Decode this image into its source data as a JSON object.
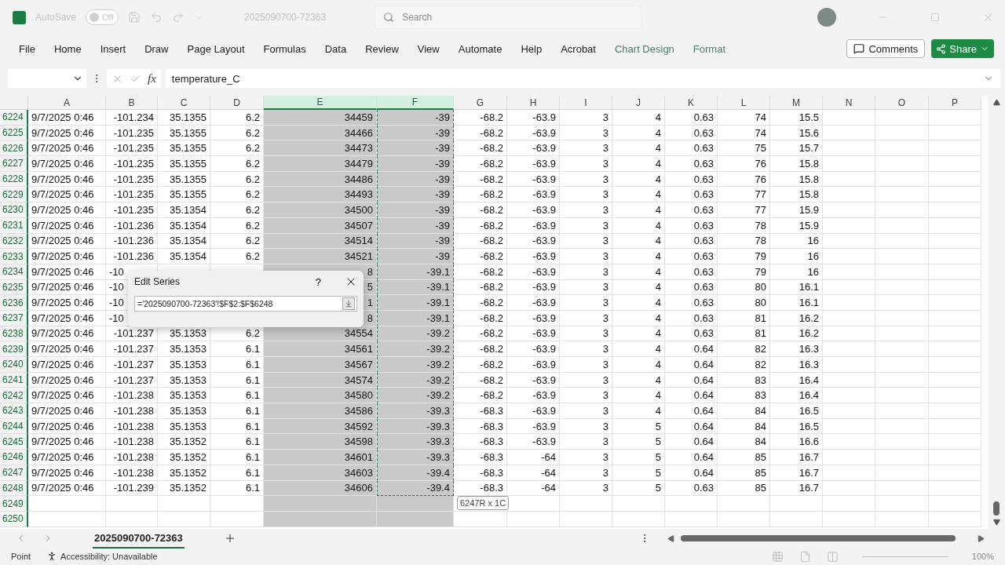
{
  "title_bar": {
    "autosave_label": "AutoSave",
    "autosave": {
      "on": false,
      "label": "Off"
    },
    "file_name": "2025090700-72363",
    "search": {
      "placeholder": "Search"
    }
  },
  "ribbon_tabs": [
    {
      "label": "File",
      "kind": "normal"
    },
    {
      "label": "Home",
      "kind": "normal"
    },
    {
      "label": "Insert",
      "kind": "normal"
    },
    {
      "label": "Draw",
      "kind": "normal"
    },
    {
      "label": "Page Layout",
      "kind": "normal"
    },
    {
      "label": "Formulas",
      "kind": "normal"
    },
    {
      "label": "Data",
      "kind": "normal"
    },
    {
      "label": "Review",
      "kind": "normal"
    },
    {
      "label": "View",
      "kind": "normal"
    },
    {
      "label": "Automate",
      "kind": "normal"
    },
    {
      "label": "Help",
      "kind": "normal"
    },
    {
      "label": "Acrobat",
      "kind": "normal"
    },
    {
      "label": "Chart Design",
      "kind": "contextual"
    },
    {
      "label": "Format",
      "kind": "contextual"
    }
  ],
  "ribbon_buttons": {
    "comments": "Comments",
    "share": "Share"
  },
  "formula_bar": {
    "fx": "fx",
    "value": "temperature_C"
  },
  "columns": [
    {
      "label": "A",
      "selected": false,
      "marquee": false
    },
    {
      "label": "B",
      "selected": false,
      "marquee": false
    },
    {
      "label": "C",
      "selected": false,
      "marquee": false
    },
    {
      "label": "D",
      "selected": false,
      "marquee": false
    },
    {
      "label": "E",
      "selected": true,
      "marquee": false
    },
    {
      "label": "F",
      "selected": true,
      "marquee": true
    },
    {
      "label": "G",
      "selected": false,
      "marquee": false
    },
    {
      "label": "H",
      "selected": false,
      "marquee": false
    },
    {
      "label": "I",
      "selected": false,
      "marquee": false
    },
    {
      "label": "J",
      "selected": false,
      "marquee": false
    },
    {
      "label": "K",
      "selected": false,
      "marquee": false
    },
    {
      "label": "L",
      "selected": false,
      "marquee": false
    },
    {
      "label": "M",
      "selected": false,
      "marquee": false
    },
    {
      "label": "N",
      "selected": false,
      "marquee": false
    },
    {
      "label": "O",
      "selected": false,
      "marquee": false
    },
    {
      "label": "P",
      "selected": false,
      "marquee": false
    }
  ],
  "rows": [
    {
      "n": "6224",
      "cells": [
        "9/7/2025 0:46",
        "-101.234",
        "35.1355",
        "6.2",
        "34459",
        "-39",
        "-68.2",
        "-63.9",
        "3",
        "4",
        "0.63",
        "74",
        "15.5"
      ]
    },
    {
      "n": "6225",
      "cells": [
        "9/7/2025 0:46",
        "-101.235",
        "35.1355",
        "6.2",
        "34466",
        "-39",
        "-68.2",
        "-63.9",
        "3",
        "4",
        "0.63",
        "74",
        "15.6"
      ]
    },
    {
      "n": "6226",
      "cells": [
        "9/7/2025 0:46",
        "-101.235",
        "35.1355",
        "6.2",
        "34473",
        "-39",
        "-68.2",
        "-63.9",
        "3",
        "4",
        "0.63",
        "75",
        "15.7"
      ]
    },
    {
      "n": "6227",
      "cells": [
        "9/7/2025 0:46",
        "-101.235",
        "35.1355",
        "6.2",
        "34479",
        "-39",
        "-68.2",
        "-63.9",
        "3",
        "4",
        "0.63",
        "76",
        "15.8"
      ]
    },
    {
      "n": "6228",
      "cells": [
        "9/7/2025 0:46",
        "-101.235",
        "35.1355",
        "6.2",
        "34486",
        "-39",
        "-68.2",
        "-63.9",
        "3",
        "4",
        "0.63",
        "76",
        "15.8"
      ]
    },
    {
      "n": "6229",
      "cells": [
        "9/7/2025 0:46",
        "-101.235",
        "35.1355",
        "6.2",
        "34493",
        "-39",
        "-68.2",
        "-63.9",
        "3",
        "4",
        "0.63",
        "77",
        "15.8"
      ]
    },
    {
      "n": "6230",
      "cells": [
        "9/7/2025 0:46",
        "-101.235",
        "35.1354",
        "6.2",
        "34500",
        "-39",
        "-68.2",
        "-63.9",
        "3",
        "4",
        "0.63",
        "77",
        "15.9"
      ]
    },
    {
      "n": "6231",
      "cells": [
        "9/7/2025 0:46",
        "-101.236",
        "35.1354",
        "6.2",
        "34507",
        "-39",
        "-68.2",
        "-63.9",
        "3",
        "4",
        "0.63",
        "78",
        "15.9"
      ]
    },
    {
      "n": "6232",
      "cells": [
        "9/7/2025 0:46",
        "-101.236",
        "35.1354",
        "6.2",
        "34514",
        "-39",
        "-68.2",
        "-63.9",
        "3",
        "4",
        "0.63",
        "78",
        "16"
      ]
    },
    {
      "n": "6233",
      "cells": [
        "9/7/2025 0:46",
        "-101.236",
        "35.1354",
        "6.2",
        "34521",
        "-39",
        "-68.2",
        "-63.9",
        "3",
        "4",
        "0.63",
        "79",
        "16"
      ]
    },
    {
      "n": "6234",
      "cells": [
        "9/7/2025 0:46",
        "-10",
        null,
        null,
        "8",
        "-39.1",
        "-68.2",
        "-63.9",
        "3",
        "4",
        "0.63",
        "79",
        "16"
      ]
    },
    {
      "n": "6235",
      "cells": [
        "9/7/2025 0:46",
        "-10",
        null,
        null,
        "5",
        "-39.1",
        "-68.2",
        "-63.9",
        "3",
        "4",
        "0.63",
        "80",
        "16.1"
      ]
    },
    {
      "n": "6236",
      "cells": [
        "9/7/2025 0:46",
        "-10",
        null,
        null,
        "1",
        "-39.1",
        "-68.2",
        "-63.9",
        "3",
        "4",
        "0.63",
        "80",
        "16.1"
      ]
    },
    {
      "n": "6237",
      "cells": [
        "9/7/2025 0:46",
        "-10",
        null,
        null,
        "8",
        "-39.1",
        "-68.2",
        "-63.9",
        "3",
        "4",
        "0.63",
        "81",
        "16.2"
      ]
    },
    {
      "n": "6238",
      "cells": [
        "9/7/2025 0:46",
        "-101.237",
        "35.1353",
        "6.2",
        "34554",
        "-39.2",
        "-68.2",
        "-63.9",
        "3",
        "4",
        "0.63",
        "81",
        "16.2"
      ]
    },
    {
      "n": "6239",
      "cells": [
        "9/7/2025 0:46",
        "-101.237",
        "35.1353",
        "6.1",
        "34561",
        "-39.2",
        "-68.2",
        "-63.9",
        "3",
        "4",
        "0.64",
        "82",
        "16.3"
      ]
    },
    {
      "n": "6240",
      "cells": [
        "9/7/2025 0:46",
        "-101.237",
        "35.1353",
        "6.1",
        "34567",
        "-39.2",
        "-68.2",
        "-63.9",
        "3",
        "4",
        "0.64",
        "82",
        "16.3"
      ]
    },
    {
      "n": "6241",
      "cells": [
        "9/7/2025 0:46",
        "-101.237",
        "35.1353",
        "6.1",
        "34574",
        "-39.2",
        "-68.2",
        "-63.9",
        "3",
        "4",
        "0.64",
        "83",
        "16.4"
      ]
    },
    {
      "n": "6242",
      "cells": [
        "9/7/2025 0:46",
        "-101.238",
        "35.1353",
        "6.1",
        "34580",
        "-39.2",
        "-68.2",
        "-63.9",
        "3",
        "4",
        "0.64",
        "83",
        "16.4"
      ]
    },
    {
      "n": "6243",
      "cells": [
        "9/7/2025 0:46",
        "-101.238",
        "35.1353",
        "6.1",
        "34586",
        "-39.3",
        "-68.3",
        "-63.9",
        "3",
        "4",
        "0.64",
        "84",
        "16.5"
      ]
    },
    {
      "n": "6244",
      "cells": [
        "9/7/2025 0:46",
        "-101.238",
        "35.1353",
        "6.1",
        "34592",
        "-39.3",
        "-68.3",
        "-63.9",
        "3",
        "5",
        "0.64",
        "84",
        "16.5"
      ]
    },
    {
      "n": "6245",
      "cells": [
        "9/7/2025 0:46",
        "-101.238",
        "35.1352",
        "6.1",
        "34598",
        "-39.3",
        "-68.3",
        "-63.9",
        "3",
        "5",
        "0.64",
        "84",
        "16.6"
      ]
    },
    {
      "n": "6246",
      "cells": [
        "9/7/2025 0:46",
        "-101.238",
        "35.1352",
        "6.1",
        "34601",
        "-39.3",
        "-68.3",
        "-64",
        "3",
        "5",
        "0.64",
        "85",
        "16.7"
      ]
    },
    {
      "n": "6247",
      "cells": [
        "9/7/2025 0:46",
        "-101.238",
        "35.1352",
        "6.1",
        "34603",
        "-39.4",
        "-68.3",
        "-64",
        "3",
        "5",
        "0.64",
        "85",
        "16.7"
      ]
    },
    {
      "n": "6248",
      "cells": [
        "9/7/2025 0:46",
        "-101.239",
        "35.1352",
        "6.1",
        "34606",
        "-39.4",
        "-68.3",
        "-64",
        "3",
        "5",
        "0.63",
        "85",
        "16.7"
      ]
    },
    {
      "n": "6249",
      "cells": []
    },
    {
      "n": "6250",
      "cells": []
    }
  ],
  "selection_tooltip": "6247R x 1C",
  "dialog": {
    "title": "Edit Series",
    "help": "?",
    "value": "='2025090700-72363'!$F$2:$F$6248"
  },
  "sheet_tabs": [
    {
      "label": "2025090700-72363",
      "selected": true
    }
  ],
  "status_bar": {
    "mode": "Point",
    "accessibility": "Accessibility: Unavailable",
    "zoom": "100%"
  }
}
